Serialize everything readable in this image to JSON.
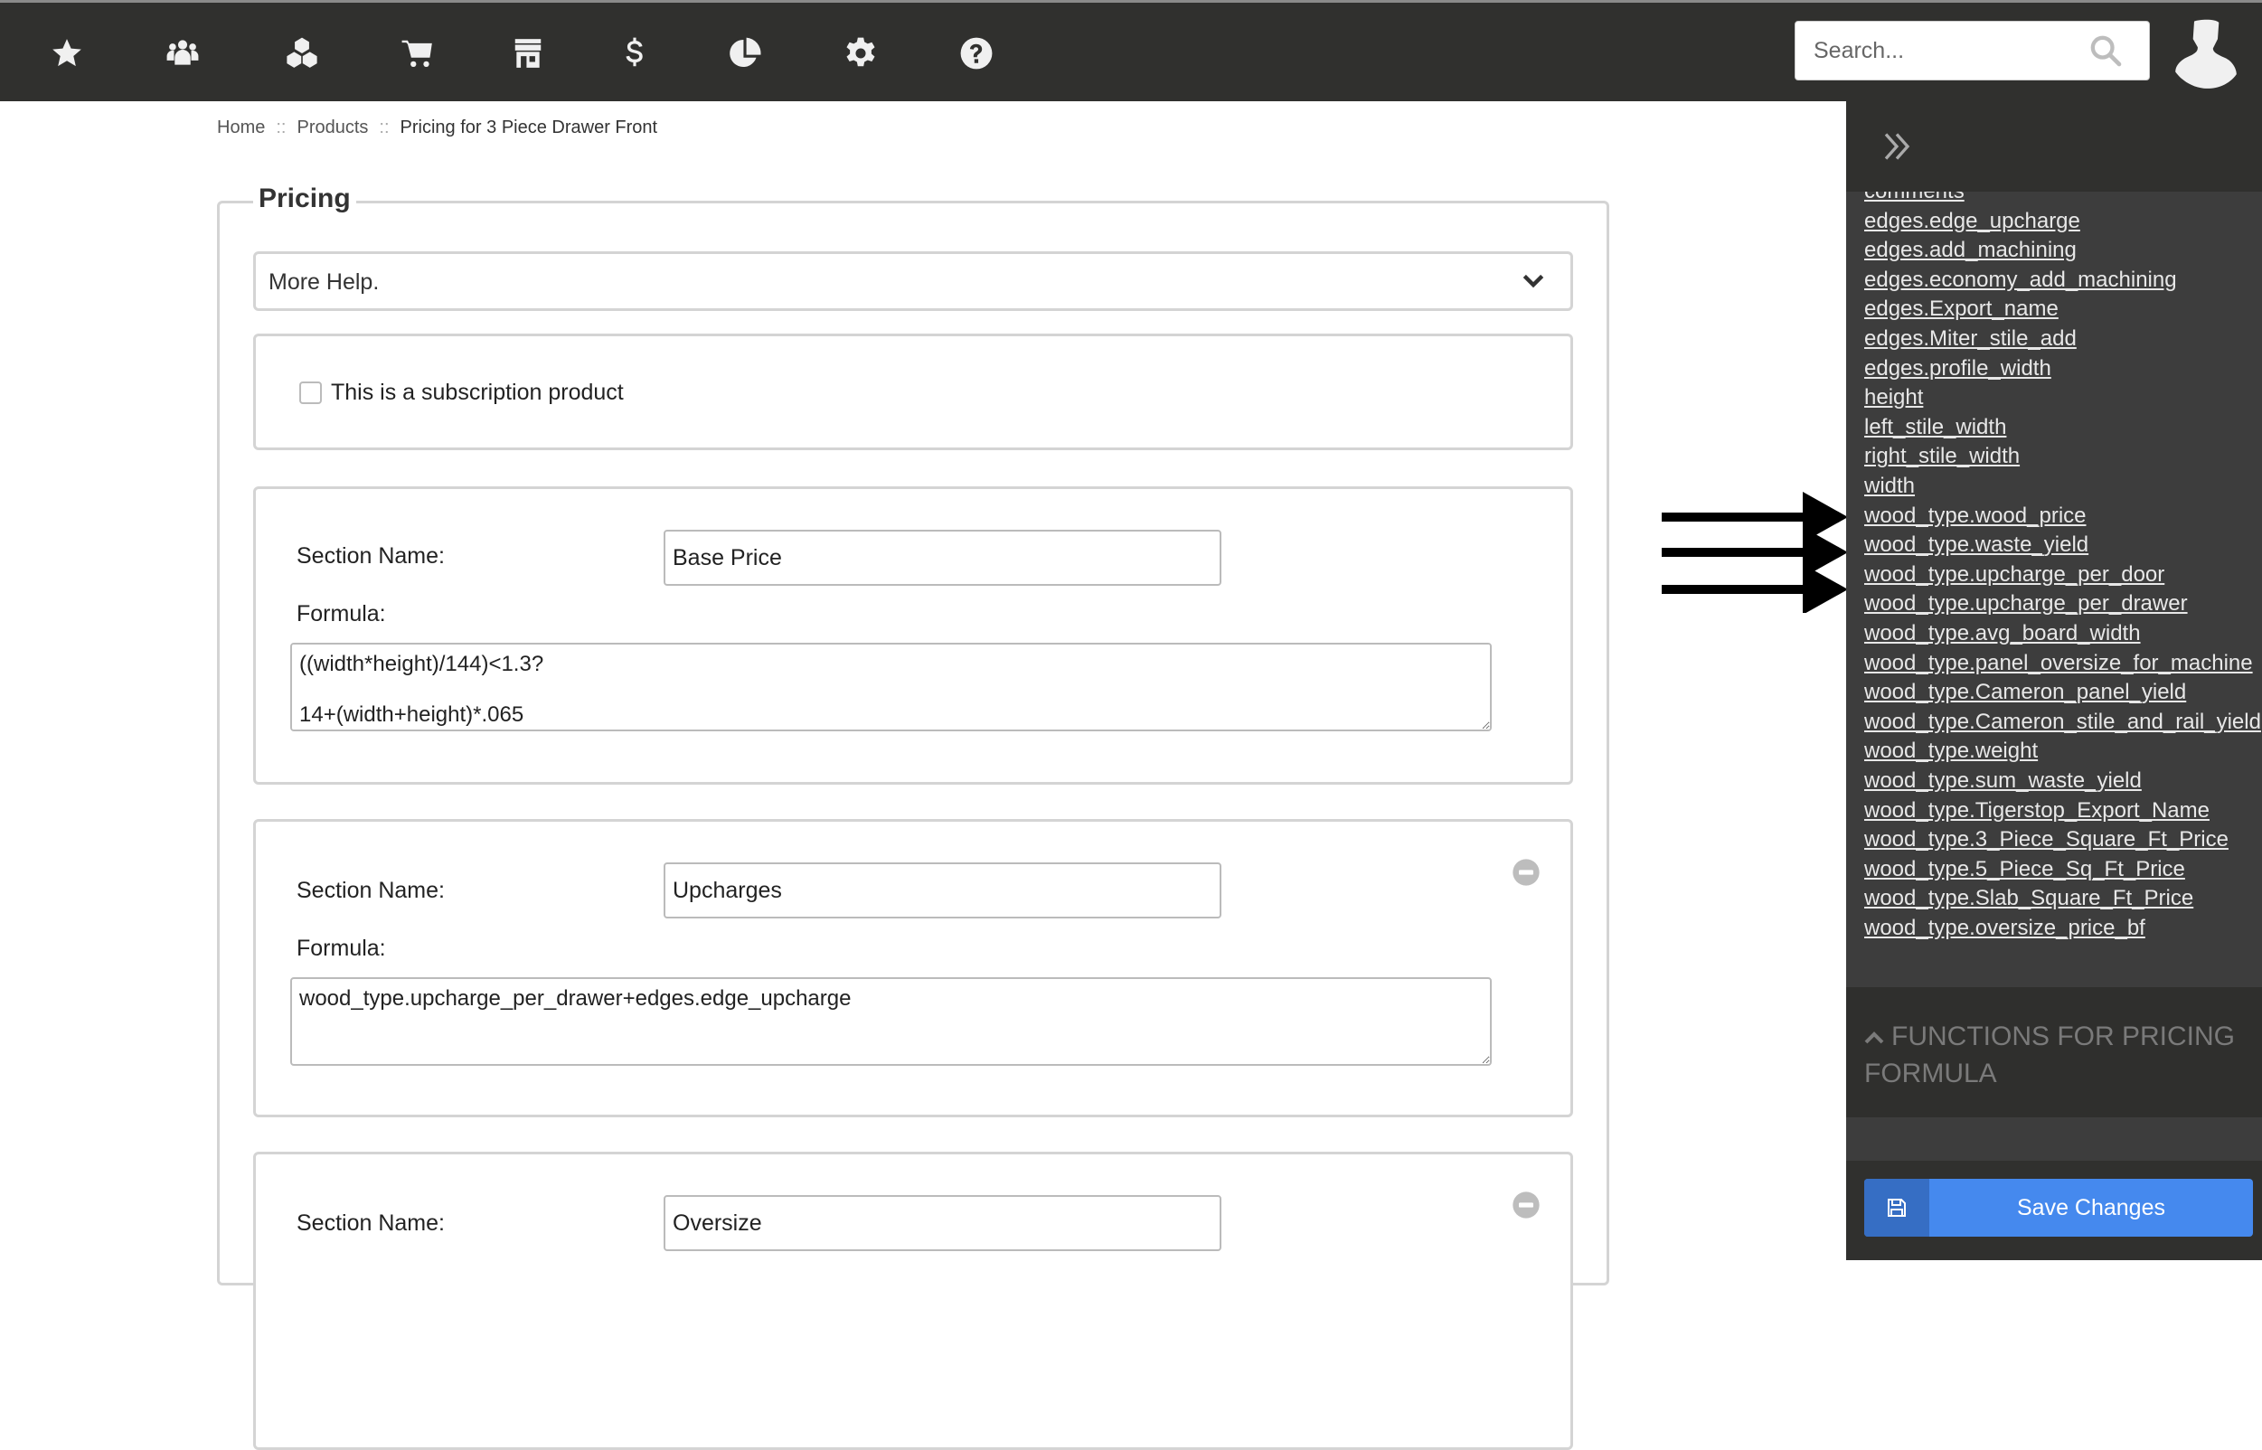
{
  "nav": {
    "icons": [
      {
        "name": "favorites",
        "icon": "star-icon"
      },
      {
        "name": "customers",
        "icon": "users-icon"
      },
      {
        "name": "products",
        "icon": "cubes-icon"
      },
      {
        "name": "orders",
        "icon": "cart-icon"
      },
      {
        "name": "store",
        "icon": "storefront-icon"
      },
      {
        "name": "billing",
        "icon": "dollar-icon"
      },
      {
        "name": "reports",
        "icon": "pie-chart-icon"
      },
      {
        "name": "settings",
        "icon": "gear-icon"
      },
      {
        "name": "help",
        "icon": "question-icon"
      }
    ],
    "search_placeholder": "Search...",
    "search_value": ""
  },
  "breadcrumb": {
    "home": "Home",
    "separator": "::",
    "products": "Products",
    "current": "Pricing for 3 Piece Drawer Front"
  },
  "pricing": {
    "legend": "Pricing",
    "help_label": "More Help.",
    "subscription_label": "This is a subscription product",
    "subscription_checked": false,
    "section_label": "Section Name:",
    "formula_label": "Formula:",
    "sections": [
      {
        "name": "Base Price",
        "formula": "((width*height)/144)<1.3?\n\n14+(width+height)*.065",
        "removable": false
      },
      {
        "name": "Upcharges",
        "formula": "wood_type.upcharge_per_drawer+edges.edge_upcharge",
        "removable": true
      },
      {
        "name": "Oversize",
        "formula": "",
        "removable": true
      }
    ]
  },
  "sidebar": {
    "variables": [
      "comments",
      "edges.edge_upcharge",
      "edges.add_machining",
      "edges.economy_add_machining",
      "edges.Export_name",
      "edges.Miter_stile_add",
      "edges.profile_width",
      "height",
      "left_stile_width",
      "right_stile_width",
      "width",
      "wood_type.wood_price",
      "wood_type.waste_yield",
      "wood_type.upcharge_per_door",
      "wood_type.upcharge_per_drawer",
      "wood_type.avg_board_width",
      "wood_type.panel_oversize_for_machine",
      "wood_type.Cameron_panel_yield",
      "wood_type.Cameron_stile_and_rail_yield",
      "wood_type.weight",
      "wood_type.sum_waste_yield",
      "wood_type.Tigerstop_Export_Name",
      "wood_type.3_Piece_Square_Ft_Price",
      "wood_type.5_Piece_Sq_Ft_Price",
      "wood_type.Slab_Square_Ft_Price",
      "wood_type.oversize_price_bf"
    ],
    "functions_heading": "Functions for Pricing Formula",
    "save_label": "Save Changes"
  },
  "colors": {
    "topbar": "#30302e",
    "sidebar": "#3d3d3d",
    "primary": "#4589ee",
    "primary_dark": "#366ec4"
  }
}
